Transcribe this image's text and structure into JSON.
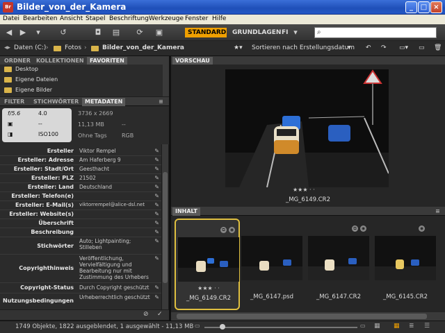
{
  "window": {
    "title": "Bilder_von_der_Kamera",
    "app_icon": "Br"
  },
  "menu": [
    "Datei",
    "Bearbeiten",
    "Ansicht",
    "Stapel",
    "Beschriftung",
    "Werkzeuge",
    "Fenster",
    "Hilfe"
  ],
  "toolbar": {
    "workspaces": {
      "standard": "STANDARD",
      "grundlagen": "GRUNDLAGEN",
      "fi": "FI"
    },
    "search_placeholder": "",
    "accent": "#f0a000"
  },
  "path": {
    "items": [
      "Daten (C:)",
      "Fotos",
      "Bilder_von_der_Kamera"
    ],
    "sort": "Sortieren nach Erstellungsdatum"
  },
  "left_tabs": {
    "ordner": "ORDNER",
    "kollektionen": "KOLLEKTIONEN",
    "favoriten": "FAVORITEN"
  },
  "favorites": [
    "Desktop",
    "Eigene Dateien",
    "Eigene Bilder"
  ],
  "meta_tabs": {
    "filter": "FILTER",
    "stichwoerter": "STICHWÖRTER",
    "metadaten": "METADATEN"
  },
  "summary": {
    "aperture": "f/5.6",
    "shutter": "4.0",
    "dash": "--",
    "iso": "ISO100",
    "dimensions": "3736 x 2669",
    "size": "11,13 MB",
    "dash2": "--",
    "tags": "Ohne Tags",
    "mode": "RGB"
  },
  "metadata": [
    {
      "label": "Ersteller",
      "value": "Viktor Rempel"
    },
    {
      "label": "Ersteller: Adresse",
      "value": "Am Haferberg 9"
    },
    {
      "label": "Ersteller: Stadt/Ort",
      "value": "Geesthacht"
    },
    {
      "label": "Ersteller: PLZ",
      "value": "21502"
    },
    {
      "label": "Ersteller: Land",
      "value": "Deutschland"
    },
    {
      "label": "Ersteller: Telefon(e)",
      "value": ""
    },
    {
      "label": "Ersteller: E-Mail(s)",
      "value": "viktorrempel@alice-dsl.net"
    },
    {
      "label": "Ersteller: Website(s)",
      "value": ""
    },
    {
      "label": "Überschrift",
      "value": ""
    },
    {
      "label": "Beschreibung",
      "value": ""
    },
    {
      "label": "Stichwörter",
      "value": "Auto; Lightpainting; Stilleben"
    },
    {
      "label": "Copyrighthinweis",
      "value": "Veröffentlichung, Vervielfältigung und Bearbeitung nur mit Zustimmung des Urhebers"
    },
    {
      "label": "Copyright-Status",
      "value": "Durch Copyright geschützt"
    },
    {
      "label": "Nutzungsbedingungen",
      "value": "Urheberrechtlich geschützt"
    }
  ],
  "preview": {
    "header": "VORSCHAU",
    "rating": "★★★ · ·",
    "filename": "_MG_6149.CR2"
  },
  "content": {
    "header": "INHALT",
    "thumbs": [
      {
        "name": "_MG_6149.CR2",
        "rating": "★★★ · ·",
        "selected": true
      },
      {
        "name": "_MG_6147.psd",
        "rating": ""
      },
      {
        "name": "_MG_6147.CR2",
        "rating": ""
      },
      {
        "name": "_MG_6145.CR2",
        "rating": ""
      }
    ]
  },
  "status": {
    "text": "1749 Objekte, 1822 ausgeblendet, 1 ausgewählt - 11,13 MB"
  }
}
